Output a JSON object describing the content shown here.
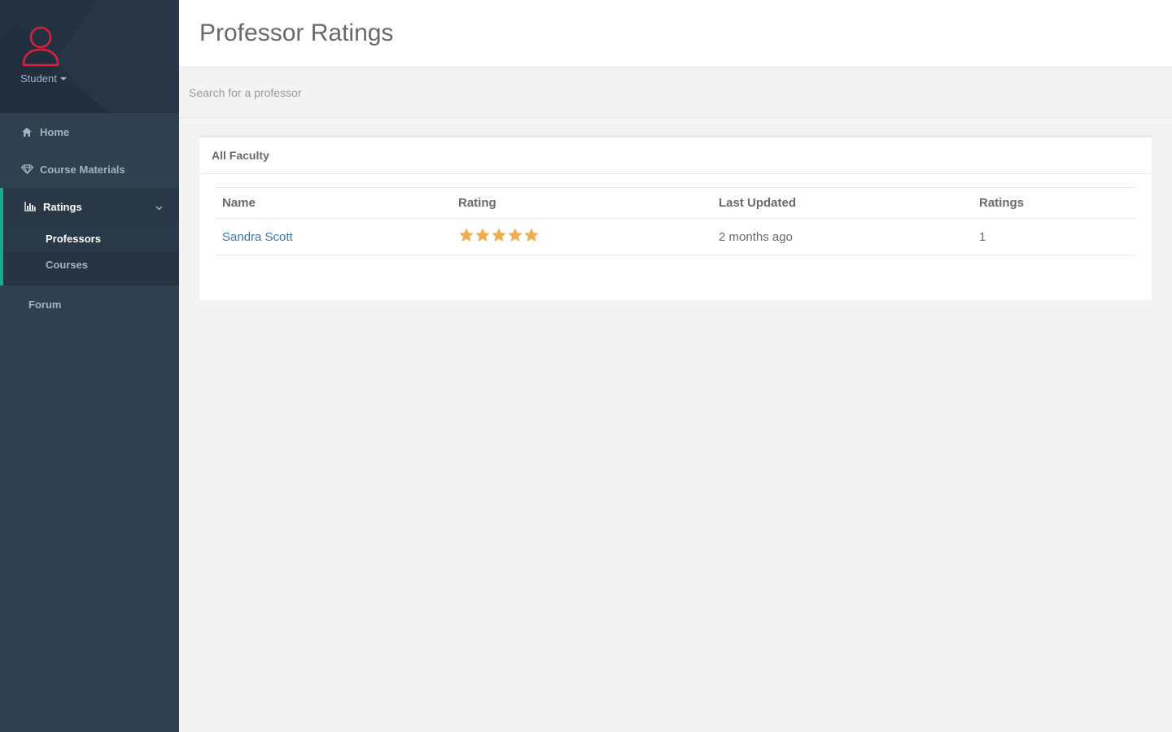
{
  "sidebar": {
    "role_label": "Student",
    "accent_color": "#19aa8d",
    "avatar_color": "#d9213f",
    "items": [
      {
        "label": "Home",
        "icon": "home-icon"
      },
      {
        "label": "Course Materials",
        "icon": "diamond-icon"
      },
      {
        "label": "Ratings",
        "icon": "bar-chart-icon",
        "active": true,
        "children": [
          {
            "label": "Professors",
            "active": true
          },
          {
            "label": "Courses",
            "active": false
          }
        ]
      },
      {
        "label": "Forum",
        "icon": ""
      }
    ]
  },
  "header": {
    "title": "Professor Ratings"
  },
  "search": {
    "placeholder": "Search for a professor",
    "value": ""
  },
  "panel": {
    "title": "All Faculty",
    "columns": [
      "Name",
      "Rating",
      "Last Updated",
      "Ratings"
    ],
    "rows": [
      {
        "name": "Sandra Scott",
        "rating": 5,
        "rating_max": 5,
        "last_updated": "2 months ago",
        "count": "1"
      }
    ],
    "star_color": "#f0ad4e"
  }
}
